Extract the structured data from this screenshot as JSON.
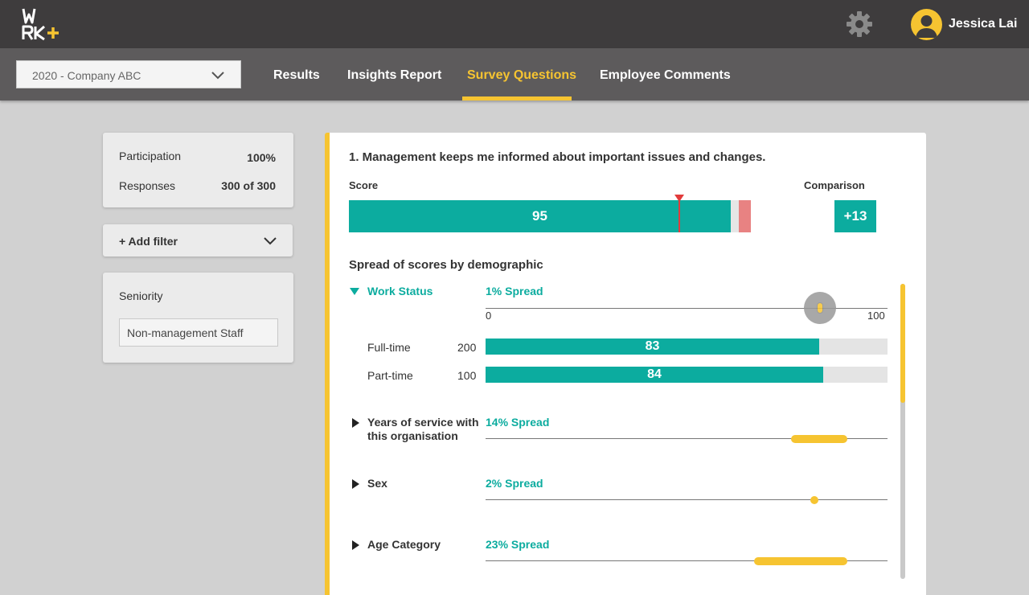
{
  "header": {
    "user_name": "Jessica Lai",
    "logo_icon": "wrk-plus-logo",
    "settings_icon": "gear-icon",
    "avatar_icon": "user-avatar-icon"
  },
  "nav": {
    "survey_select": "2020 - Company ABC",
    "tabs": [
      {
        "label": "Results",
        "active": false
      },
      {
        "label": "Insights Report",
        "active": false
      },
      {
        "label": "Survey Questions",
        "active": true
      },
      {
        "label": "Employee Comments",
        "active": false
      }
    ]
  },
  "sidebar": {
    "participation_label": "Participation",
    "participation_value": "100%",
    "responses_label": "Responses",
    "responses_value": "300 of 300",
    "add_filter": "+ Add filter",
    "seniority_label": "Seniority",
    "seniority_value": "Non-management Staff"
  },
  "question": {
    "title": "1. Management keeps me informed about important issues and changes.",
    "score_label": "Score",
    "score": "95",
    "score_fraction": 0.95,
    "comparison_label": "Comparison",
    "comparison": "+13"
  },
  "spread": {
    "heading": "Spread of scores by demographic",
    "groups": [
      {
        "name": "Work Status",
        "spread": "1% Spread",
        "expanded": true,
        "scale_min": "0",
        "scale_max": "100",
        "rows": [
          {
            "label": "Full-time",
            "count": "200",
            "value": "83",
            "fraction": 0.83
          },
          {
            "label": "Part-time",
            "count": "100",
            "value": "84",
            "fraction": 0.84
          }
        ]
      },
      {
        "name_line1": "Years of service with",
        "name_line2": "this organisation",
        "spread": "14% Spread",
        "expanded": false
      },
      {
        "name": "Sex",
        "spread": "2% Spread",
        "expanded": false
      },
      {
        "name": "Age Category",
        "spread": "23% Spread",
        "expanded": false
      }
    ]
  },
  "colors": {
    "accent": "#f6c431",
    "teal": "#0cac9f",
    "header_bg": "#3e3c3d",
    "nav_bg": "#5d5b5c",
    "marker_red": "#e23b3b"
  }
}
